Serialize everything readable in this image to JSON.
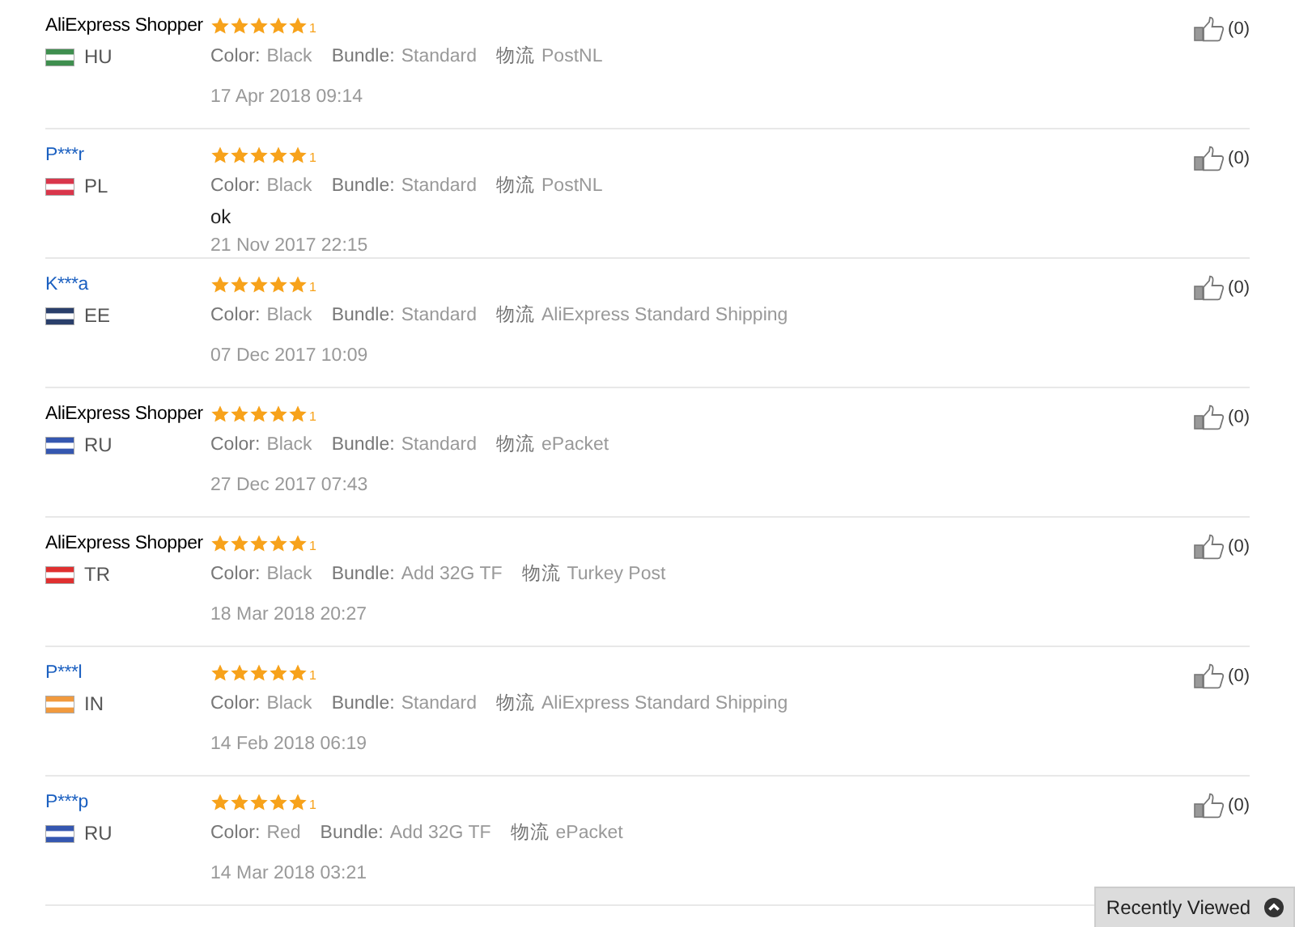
{
  "reviews": [
    {
      "name": "AliExpress Shopper",
      "linked": false,
      "country": "HU",
      "color": "#3f8f4f",
      "stars": 5,
      "rank": "1",
      "attributes": [
        {
          "label": "Color:",
          "value": "Black"
        },
        {
          "label": "Bundle:",
          "value": "Standard"
        },
        {
          "label": "物流",
          "value": "PostNL"
        }
      ],
      "date": "17 Apr 2018 09:14",
      "likes": "(0)"
    },
    {
      "name": "P***r",
      "linked": true,
      "country": "PL",
      "color": "#d9364b",
      "stars": 5,
      "rank": "1",
      "attributes": [
        {
          "label": "Color:",
          "value": "Black"
        },
        {
          "label": "Bundle:",
          "value": "Standard"
        },
        {
          "label": "物流",
          "value": "PostNL"
        }
      ],
      "comment": "ok",
      "date": "21 Nov 2017 22:15",
      "likes": "(0)"
    },
    {
      "name": "K***a",
      "linked": true,
      "country": "EE",
      "color": "#2a3f6b",
      "stars": 5,
      "rank": "1",
      "attributes": [
        {
          "label": "Color:",
          "value": "Black"
        },
        {
          "label": "Bundle:",
          "value": "Standard"
        },
        {
          "label": "物流",
          "value": "AliExpress Standard Shipping"
        }
      ],
      "date": "07 Dec 2017 10:09",
      "likes": "(0)"
    },
    {
      "name": "AliExpress Shopper",
      "linked": false,
      "country": "RU",
      "color": "#3557b0",
      "stars": 5,
      "rank": "1",
      "attributes": [
        {
          "label": "Color:",
          "value": "Black"
        },
        {
          "label": "Bundle:",
          "value": "Standard"
        },
        {
          "label": "物流",
          "value": "ePacket"
        }
      ],
      "date": "27 Dec 2017 07:43",
      "likes": "(0)"
    },
    {
      "name": "AliExpress Shopper",
      "linked": false,
      "country": "TR",
      "color": "#e03030",
      "stars": 5,
      "rank": "1",
      "attributes": [
        {
          "label": "Color:",
          "value": "Black"
        },
        {
          "label": "Bundle:",
          "value": "Add 32G TF"
        },
        {
          "label": "物流",
          "value": "Turkey Post"
        }
      ],
      "date": "18 Mar 2018 20:27",
      "likes": "(0)"
    },
    {
      "name": "P***l",
      "linked": true,
      "country": "IN",
      "color": "#f19a3e",
      "stars": 5,
      "rank": "1",
      "attributes": [
        {
          "label": "Color:",
          "value": "Black"
        },
        {
          "label": "Bundle:",
          "value": "Standard"
        },
        {
          "label": "物流",
          "value": "AliExpress Standard Shipping"
        }
      ],
      "date": "14 Feb 2018 06:19",
      "likes": "(0)"
    },
    {
      "name": "P***p",
      "linked": true,
      "country": "RU",
      "color": "#3557b0",
      "stars": 5,
      "rank": "1",
      "attributes": [
        {
          "label": "Color:",
          "value": "Red"
        },
        {
          "label": "Bundle:",
          "value": "Add 32G TF"
        },
        {
          "label": "物流",
          "value": "ePacket"
        }
      ],
      "date": "14 Mar 2018 03:21",
      "likes": "(0)"
    }
  ],
  "recently_viewed": {
    "label": "Recently Viewed"
  }
}
